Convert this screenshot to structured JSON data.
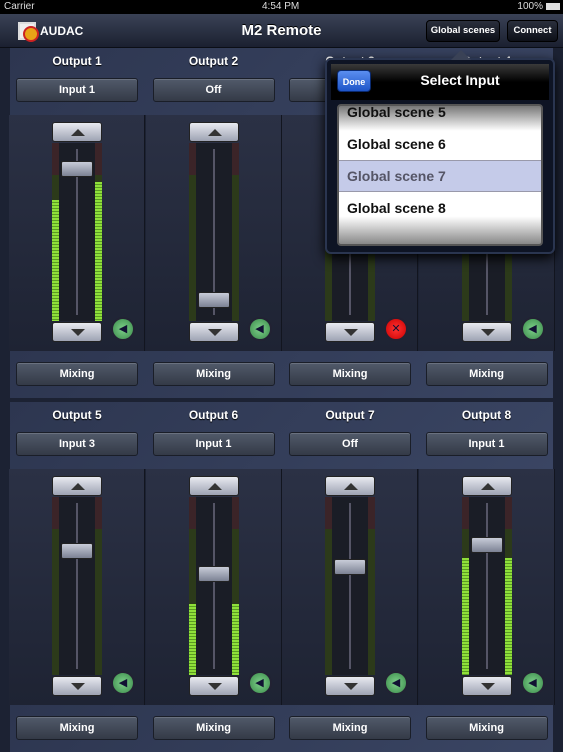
{
  "status": {
    "carrier": "Carrier",
    "time": "4:54 PM",
    "battery": "100%"
  },
  "navbar": {
    "logo": "AUDAC",
    "title": "M2 Remote",
    "global_scenes": "Global scenes",
    "connect": "Connect"
  },
  "channels": [
    {
      "name": "Output 1",
      "input": "Input 1",
      "mode": "Mixing",
      "fader": 0.89,
      "meter_l": 0.68,
      "meter_r": 0.78,
      "muted": false
    },
    {
      "name": "Output 2",
      "input": "Off",
      "mode": "Mixing",
      "fader": 0.07,
      "meter_l": 0,
      "meter_r": 0,
      "muted": false
    },
    {
      "name": "Output 3",
      "input": "",
      "mode": "Mixing",
      "fader": 0.5,
      "meter_l": 0,
      "meter_r": 0,
      "muted": true
    },
    {
      "name": "Output 4",
      "input": "",
      "mode": "Mixing",
      "fader": 0.5,
      "meter_l": 0,
      "meter_r": 0,
      "muted": false
    },
    {
      "name": "Output 5",
      "input": "Input 3",
      "mode": "Mixing",
      "fader": 0.71,
      "meter_l": 0,
      "meter_r": 0,
      "muted": false
    },
    {
      "name": "Output 6",
      "input": "Input 1",
      "mode": "Mixing",
      "fader": 0.57,
      "meter_l": 0.4,
      "meter_r": 0.4,
      "muted": false
    },
    {
      "name": "Output 7",
      "input": "Off",
      "mode": "Mixing",
      "fader": 0.61,
      "meter_l": 0,
      "meter_r": 0,
      "muted": false
    },
    {
      "name": "Output 8",
      "input": "Input 1",
      "mode": "Mixing",
      "fader": 0.75,
      "meter_l": 0.66,
      "meter_r": 0.66,
      "muted": false
    }
  ],
  "popover": {
    "done": "Done",
    "title": "Select Input",
    "options": [
      "Global scene 5",
      "Global scene 6",
      "Global scene 7",
      "Global scene 8"
    ],
    "selected": "Global scene 7"
  },
  "colors": {
    "meter": "#8fe03a",
    "mute_on": "#3a8a4a",
    "mute_off": "#cc0000",
    "done": "#1e55c8"
  }
}
